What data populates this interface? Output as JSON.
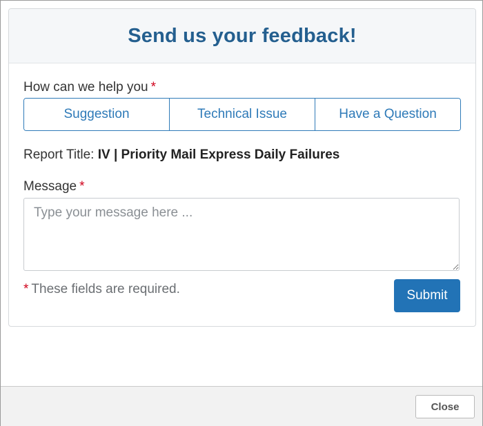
{
  "panel": {
    "title": "Send us your feedback!"
  },
  "help": {
    "label": "How can we help you",
    "required_mark": "*",
    "options": [
      "Suggestion",
      "Technical Issue",
      "Have a Question"
    ]
  },
  "report": {
    "label": "Report Title:",
    "value": "IV | Priority Mail Express Daily Failures"
  },
  "message": {
    "label": "Message",
    "required_mark": "*",
    "value": "",
    "placeholder": "Type your message here ..."
  },
  "required_note": {
    "mark": "*",
    "text": "These fields are required."
  },
  "submit": {
    "label": "Submit"
  },
  "footer": {
    "close_label": "Close"
  },
  "colors": {
    "accent": "#2273b6",
    "title": "#245f8f",
    "required": "#d0021b"
  }
}
